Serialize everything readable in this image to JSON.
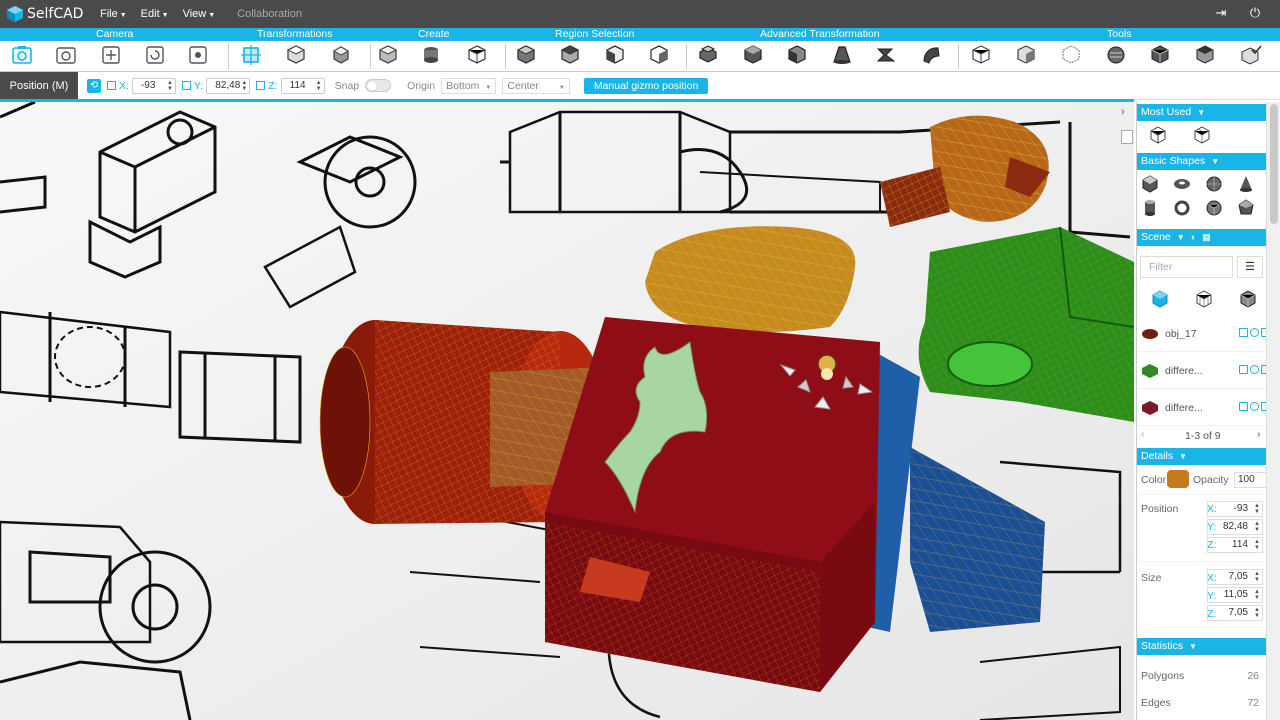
{
  "app": {
    "name": "SelfCAD"
  },
  "menu": [
    {
      "label": "File"
    },
    {
      "label": "Edit"
    },
    {
      "label": "View"
    }
  ],
  "menu_disabled": "Collaboration",
  "ribbon": {
    "groups": [
      "Camera",
      "Transformations",
      "Create",
      "Region Selection",
      "Advanced Transformation",
      "Tools"
    ]
  },
  "position_bar": {
    "tab": "Position (M)",
    "x_label": "X:",
    "x_value": "-93",
    "y_label": "Y:",
    "y_value": "82,48",
    "z_label": "Z:",
    "z_value": "114",
    "snap_label": "Snap",
    "origin_label": "Origin",
    "origin_value": "Bottom",
    "center_value": "Center",
    "gizmo_button": "Manual gizmo position"
  },
  "panel": {
    "most_used": "Most Used",
    "basic_shapes": "Basic Shapes",
    "scene": "Scene",
    "filter_placeholder": "Filter",
    "objects": [
      {
        "name": "obj_17",
        "color": "#6e2010"
      },
      {
        "name": "differe...",
        "color": "#2f8a22"
      },
      {
        "name": "differe...",
        "color": "#7a1a2a"
      }
    ],
    "pager": "1-3 of 9",
    "details": "Details",
    "color_label": "Color",
    "color_value": "#c57a1c",
    "opacity_label": "Opacity",
    "opacity_value": "100",
    "position_label": "Position",
    "pos_x": "-93",
    "pos_y": "82,48",
    "pos_z": "114",
    "size_label": "Size",
    "size_x": "7,05",
    "size_y": "11,05",
    "size_z": "7,05",
    "statistics": "Statistics",
    "polygons_label": "Polygons",
    "polygons_value": "26",
    "edges_label": "Edges",
    "edges_value": "72"
  },
  "colors": {
    "accent": "#19b5e7",
    "menubar": "#4a4a4a"
  }
}
